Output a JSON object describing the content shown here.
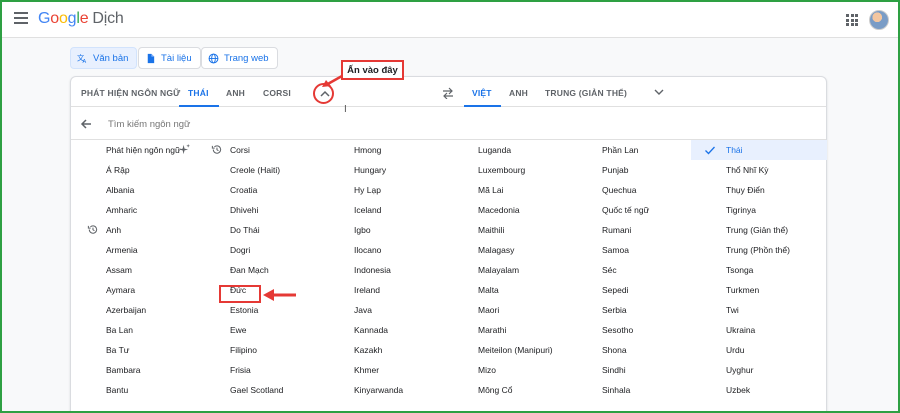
{
  "app": {
    "logo": [
      "G",
      "o",
      "o",
      "g",
      "l",
      "e"
    ],
    "product": "Dịch"
  },
  "modes": [
    {
      "label": "Văn bản",
      "icon": "translate-icon"
    },
    {
      "label": "Tài liệu",
      "icon": "document-icon"
    },
    {
      "label": "Trang web",
      "icon": "globe-icon"
    }
  ],
  "source_tabs": [
    "PHÁT HIỆN NGÔN NGỮ",
    "THÁI",
    "ANH",
    "CORSI"
  ],
  "target_tabs": [
    "VIỆT",
    "ANH",
    "TRUNG (GIẢN THỂ)"
  ],
  "search": {
    "placeholder": "Tìm kiếm ngôn ngữ"
  },
  "annotation": {
    "callout": "Ấn vào đây"
  },
  "columns": [
    [
      "Phát hiện ngôn ngữ",
      "Á Rập",
      "Albania",
      "Amharic",
      "Anh",
      "Armenia",
      "Assam",
      "Aymara",
      "Azerbaijan",
      "Ba Lan",
      "Ba Tư",
      "Bambara",
      "Bantu"
    ],
    [
      "Corsi",
      "Creole (Haiti)",
      "Croatia",
      "Dhivehi",
      "Do Thái",
      "Dogri",
      "Đan Mạch",
      "Đức",
      "Estonia",
      "Ewe",
      "Filipino",
      "Frisia",
      "Gael Scotland"
    ],
    [
      "Hmong",
      "Hungary",
      "Hy Lạp",
      "Iceland",
      "Igbo",
      "Ilocano",
      "Indonesia",
      "Ireland",
      "Java",
      "Kannada",
      "Kazakh",
      "Khmer",
      "Kinyarwanda"
    ],
    [
      "Luganda",
      "Luxembourg",
      "Mã Lai",
      "Macedonia",
      "Maithili",
      "Malagasy",
      "Malayalam",
      "Malta",
      "Maori",
      "Marathi",
      "Meiteilon (Manipuri)",
      "Mizo",
      "Mông Cổ"
    ],
    [
      "Phần Lan",
      "Punjab",
      "Quechua",
      "Quốc tế ngữ",
      "Rumani",
      "Samoa",
      "Séc",
      "Sepedi",
      "Serbia",
      "Sesotho",
      "Shona",
      "Sindhi",
      "Sinhala"
    ],
    [
      "Thái",
      "Thổ Nhĩ Kỳ",
      "Thụy Điển",
      "Tigrinya",
      "Trung (Giản thể)",
      "Trung (Phồn thể)",
      "Tsonga",
      "Turkmen",
      "Twi",
      "Ukraina",
      "Urdu",
      "Uyghur",
      "Uzbek"
    ]
  ],
  "colors": {
    "accent": "#1a73e8",
    "highlight": "#e53935",
    "frame": "#2ea043"
  }
}
